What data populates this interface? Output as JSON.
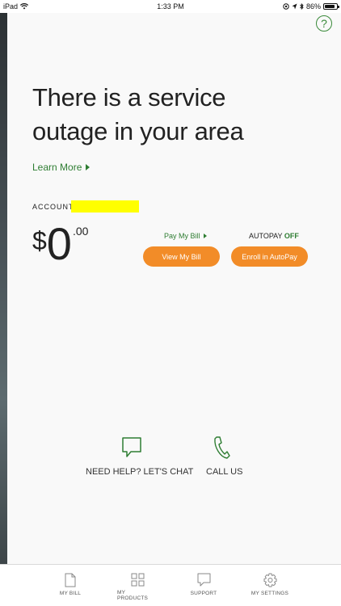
{
  "status_bar": {
    "device": "iPad",
    "time": "1:33 PM",
    "battery": "86%",
    "battery_level": 0.86
  },
  "header": {
    "help_glyph": "?"
  },
  "outage": {
    "headline": "There is a service outage in your area",
    "learn_more": "Learn More"
  },
  "account": {
    "label": "ACCOUNT :",
    "value_redacted": true
  },
  "balance": {
    "currency": "$",
    "whole": "0",
    "cents": ".00"
  },
  "billing": {
    "pay_link": "Pay My Bill",
    "autopay_label": "AUTOPAY",
    "autopay_value": "OFF",
    "view_bill_button": "View My Bill",
    "enroll_button": "Enroll in AutoPay"
  },
  "help": {
    "chat_label": "NEED HELP? LET'S CHAT",
    "call_label": "CALL US"
  },
  "tabs": [
    {
      "label": "MY BILL",
      "icon": "document-icon"
    },
    {
      "label": "MY PRODUCTS",
      "icon": "grid-icon"
    },
    {
      "label": "SUPPORT",
      "icon": "chat-icon"
    },
    {
      "label": "MY SETTINGS",
      "icon": "gear-icon"
    }
  ],
  "colors": {
    "accent_green": "#2e7d32",
    "button_orange": "#f28c28",
    "redaction_yellow": "#ffff00"
  }
}
